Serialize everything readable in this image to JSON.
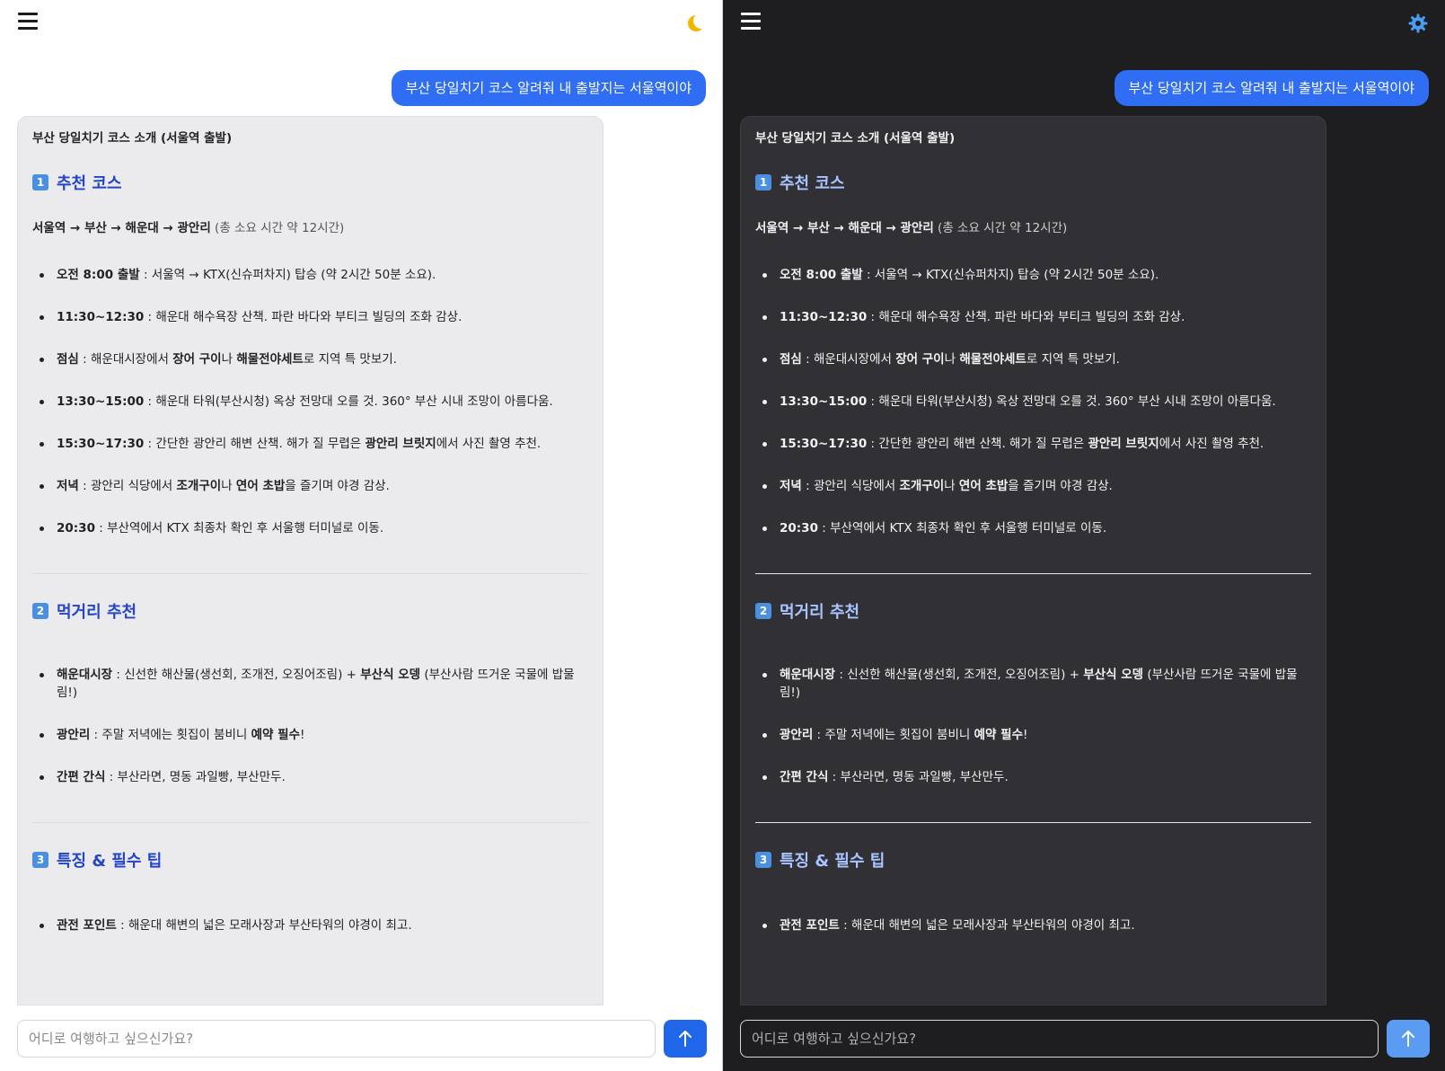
{
  "colors": {
    "accent": "#2f6ef2",
    "heading_light": "#2345c8",
    "heading_dark": "#aac4ff",
    "moon": "#f4b400",
    "gear": "#4a9cf0"
  },
  "icons": {
    "menu": "hamburger-menu-icon",
    "light_theme_toggle": "moon-icon",
    "dark_theme_toggle": "gear-icon",
    "send": "arrow-up-icon"
  },
  "chat": {
    "user_message": "부산 당일치기 코스 알려줘 내 출발지는 서울역이야",
    "answer": {
      "title": "부산 당일치기 코스 소개 (서울역 출발)",
      "section1": {
        "badge": "1",
        "heading": "추천 코스",
        "route_bold": "서울역 → 부산 → 해운대 → 광안리",
        "route_note": " (총 소요 시간 약 12시간)",
        "items": [
          {
            "label": "오전 8:00 출발",
            "text": " : 서울역 → KTX(신슈퍼차지) 탑승 (약 2시간 50분 소요)."
          },
          {
            "label": "11:30~12:30",
            "text": " : 해운대 해수욕장 산책. 파란 바다와 부티크 빌딩의 조화 감상."
          },
          {
            "label": "점심",
            "text_a": " : 해운대시장에서 ",
            "bold_a": "장어 구이",
            "text_b": "나 ",
            "bold_b": "해물전야세트",
            "text_c": "로 지역 특 맛보기."
          },
          {
            "label": "13:30~15:00",
            "text": " : 해운대 타워(부산시청) 옥상 전망대 오를 것. 360° 부산 시내 조망이 아름다움."
          },
          {
            "label": "15:30~17:30",
            "text_a": " : 간단한 광안리 해변 산책. 해가 질 무렵은 ",
            "bold_a": "광안리 브릿지",
            "text_b": "에서 사진 촬영 추천."
          },
          {
            "label": "저녁",
            "text_a": " : 광안리 식당에서 ",
            "bold_a": "조개구이",
            "text_b": "나 ",
            "bold_b": "연어 초밥",
            "text_c": "을 즐기며 야경 감상."
          },
          {
            "label": "20:30",
            "text": " : 부산역에서 KTX 최종차 확인 후 서울행 터미널로 이동."
          }
        ]
      },
      "section2": {
        "badge": "2",
        "heading": "먹거리 추천",
        "items": [
          {
            "label": "해운대시장",
            "text_a": " : 신선한 해산물(생선회, 조개전, 오징어조림) + ",
            "bold_a": "부산식 오뎅",
            "text_b": " (부산사람 뜨거운 국물에 밥물 림!)"
          },
          {
            "label": "광안리",
            "text_a": " : 주말 저녁에는 횟집이 붐비니 ",
            "bold_a": "예약 필수",
            "text_b": "!"
          },
          {
            "label": "간편 간식",
            "text": " : 부산라면, 명동 과일빵, 부산만두."
          }
        ]
      },
      "section3": {
        "badge": "3",
        "heading": "특징 & 필수 팁",
        "items": [
          {
            "label": "관전 포인트",
            "text": " : 해운대 해변의 넓은 모래사장과 부산타워의 야경이 최고."
          }
        ]
      }
    },
    "input_placeholder": "어디로 여행하고 싶으신가요?"
  }
}
